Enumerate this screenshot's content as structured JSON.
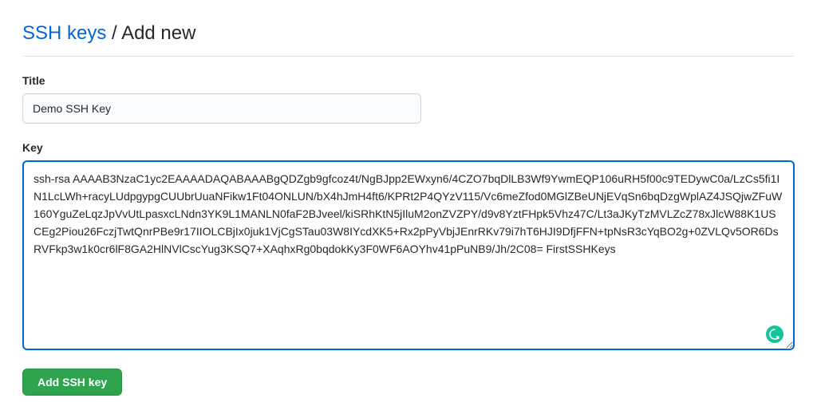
{
  "breadcrumb": {
    "parent_label": "SSH keys",
    "separator": " / ",
    "current_label": "Add new"
  },
  "form": {
    "title_label": "Title",
    "title_value": "Demo SSH Key",
    "key_label": "Key",
    "key_value": "ssh-rsa AAAAB3NzaC1yc2EAAAADAQABAAABgQDZgb9gfcoz4t/NgBJpp2EWxyn6/4CZO7bqDlLB3Wf9YwmEQP106uRH5f00c9TEDywC0a/LzCs5fi1IN1LcLWh+racyLUdpgypgCUUbrUuaNFikw1Ft04ONLUN/bX4hJmH4ft6/KPRt2P4QYzV115/Vc6meZfod0MGlZBeUNjEVqSn6bqDzgWplAZ4JSQjwZFuW160YguZeLqzJpVvUtLpasxcLNdn3YK9L1MANLN0faF2BJveel/kiSRhKtN5jIluM2onZVZPY/d9v8YztFHpk5Vhz47C/Lt3aJKyTzMVLZcZ78xJlcW88K1USCEg2Piou26FczjTwtQnrPBe9r17IIOLCBjIx0juk1VjCgSTau03W8IYcdXK5+Rx2pPyVbjJEnrRKv79i7hT6HJI9DfjFFN+tpNsR3cYqBO2g+0ZVLQv5OR6DsRVFkp3w1k0cr6lF8GA2HlNVlCscYug3KSQ7+XAqhxRg0bqdokKy3F0WF6AOYhv41pPuNB9/Jh/2C08= FirstSSHKeys",
    "submit_label": "Add SSH key"
  }
}
